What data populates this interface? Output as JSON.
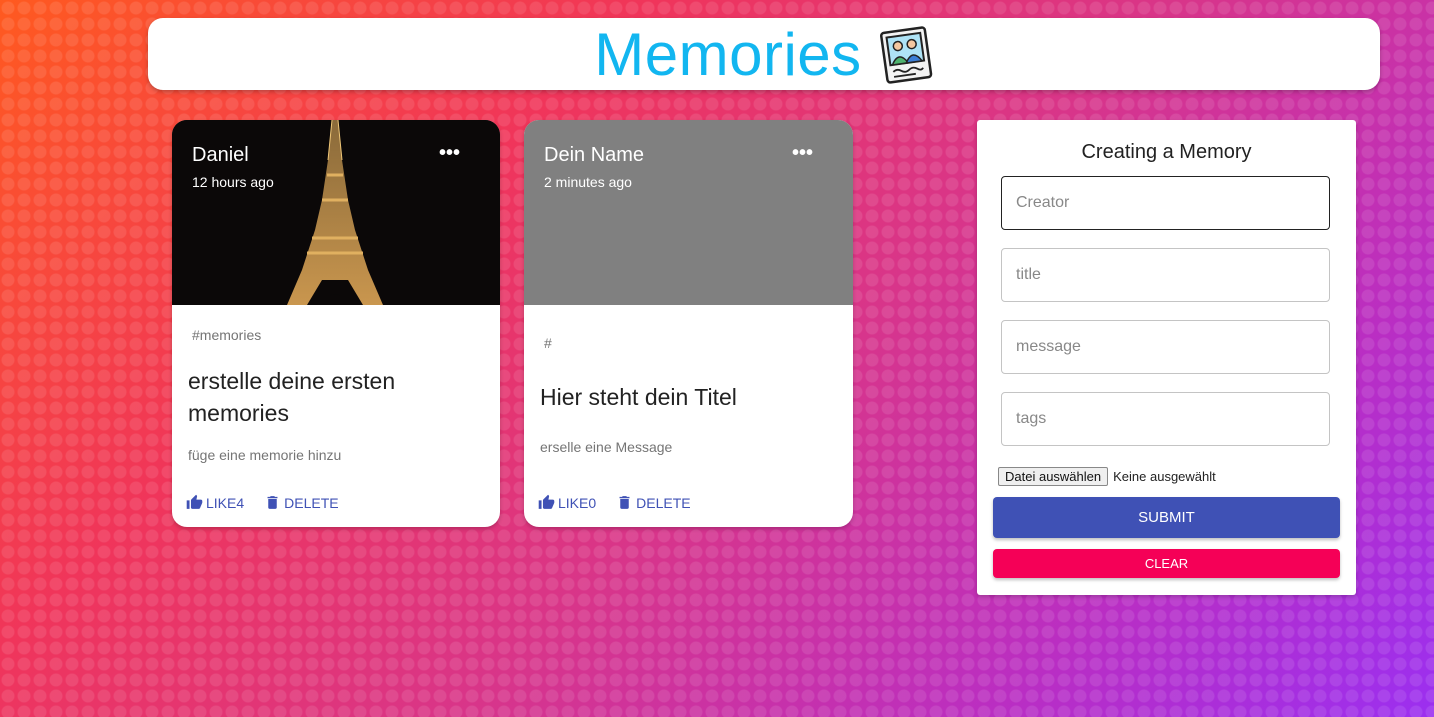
{
  "header": {
    "title": "Memories",
    "logo_icon": "photo-memories-icon"
  },
  "posts": [
    {
      "creator": "Daniel",
      "time": "12 hours ago",
      "tags": "#memories",
      "title": "erstelle deine ersten memories",
      "message": "füge eine memorie hinzu",
      "like_label": "LIKE4",
      "delete_label": "DELETE",
      "media": "eiffel-tower-night-photo"
    },
    {
      "creator": "Dein Name",
      "time": "2 minutes ago",
      "tags": "#",
      "title": "Hier steht dein Titel",
      "message": "erselle eine Message",
      "like_label": "LIKE0",
      "delete_label": "DELETE",
      "media": "gray-placeholder"
    }
  ],
  "form": {
    "title": "Creating a Memory",
    "creator_placeholder": "Creator",
    "title_placeholder": "title",
    "message_placeholder": "message",
    "tags_placeholder": "tags",
    "file_button": "Datei auswählen",
    "file_status": "Keine ausgewählt",
    "submit_label": "SUBMIT",
    "clear_label": "CLEAR"
  },
  "colors": {
    "title": "#12b6f0",
    "primary": "#3f51b5",
    "secondary": "#f50057",
    "placeholder_media": "#808080"
  }
}
